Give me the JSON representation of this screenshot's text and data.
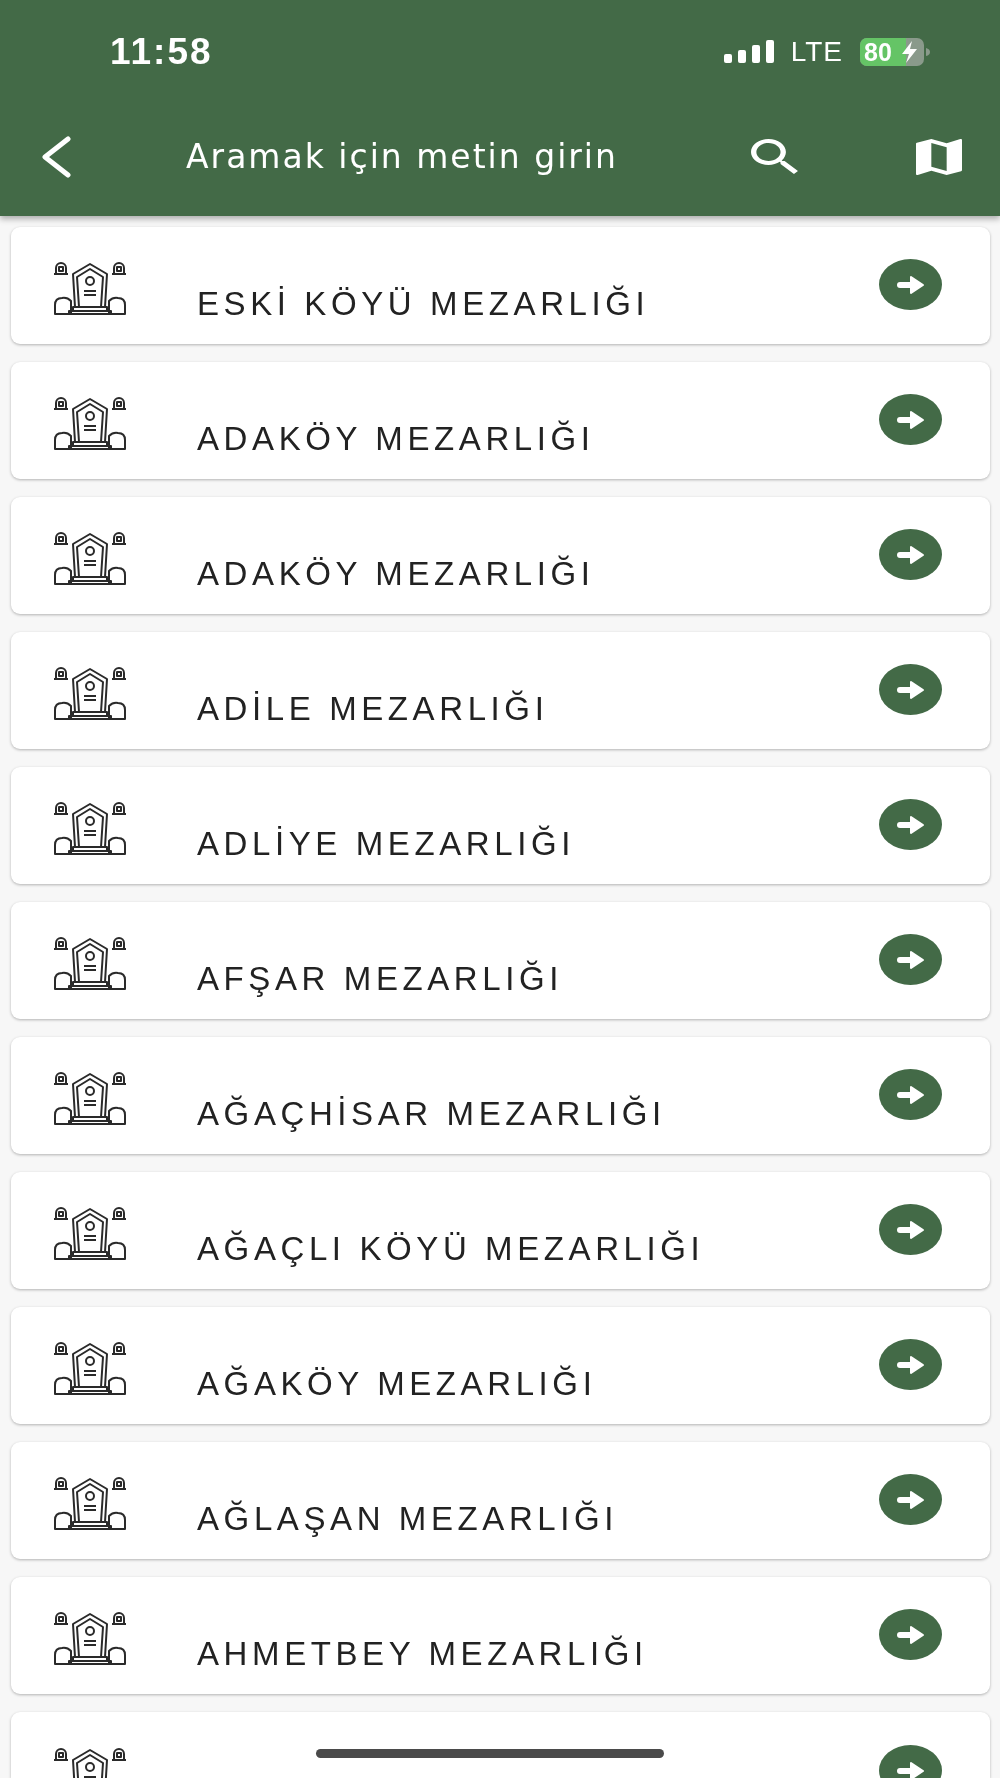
{
  "status_bar": {
    "time": "11:58",
    "network": "LTE",
    "battery": "80"
  },
  "app_bar": {
    "title": "Aramak için metin girin"
  },
  "items": [
    {
      "kind": "full",
      "title": "ESKİ KÖYÜ MEZARLIĞI"
    },
    {
      "kind": "full",
      "title": "ADAKÖY MEZARLIĞI"
    },
    {
      "kind": "full",
      "title": "ADAKÖY MEZARLIĞI"
    },
    {
      "kind": "full",
      "title": "ADİLE MEZARLIĞI"
    },
    {
      "kind": "full",
      "title": "ADLİYE MEZARLIĞI"
    },
    {
      "kind": "full",
      "title": "AFŞAR MEZARLIĞI"
    },
    {
      "kind": "full",
      "title": "AĞAÇHİSAR MEZARLIĞI"
    },
    {
      "kind": "full",
      "title": "AĞAÇLI KÖYÜ MEZARLIĞI"
    },
    {
      "kind": "full",
      "title": "AĞAKÖY MEZARLIĞI"
    },
    {
      "kind": "full",
      "title": "AĞLAŞAN MEZARLIĞI"
    },
    {
      "kind": "full",
      "title": "AHMETBEY MEZARLIĞI"
    },
    {
      "kind": "cut"
    }
  ]
}
